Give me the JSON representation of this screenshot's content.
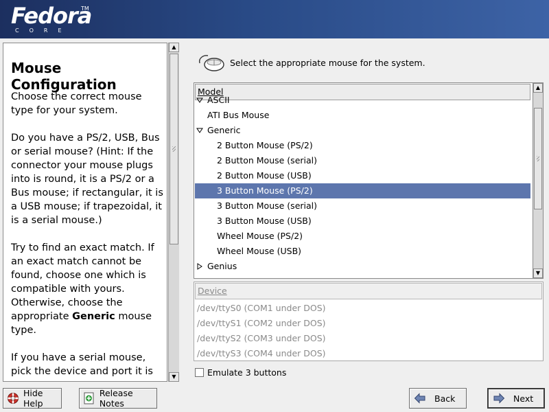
{
  "banner": {
    "logo_text": "Fedora",
    "tm": "TM",
    "core_text": "CORE"
  },
  "help": {
    "title": "Mouse Configuration",
    "paragraph1": "Choose the correct mouse type for your system.",
    "paragraph2": "Do you have a PS/2, USB, Bus or serial mouse? (Hint: If the connector your mouse plugs into is round, it is a PS/2 or a Bus mouse; if rectangular, it is a USB mouse; if trapezoidal, it is a serial mouse.)",
    "paragraph3_pre": "Try to find an exact match. If an exact match cannot be found, choose one which is compatible with yours. Otherwise, choose the appropriate ",
    "paragraph3_bold": "Generic",
    "paragraph3_post": " mouse type.",
    "paragraph4": "If you have a serial mouse, pick the device and port it is"
  },
  "instruction": "Select the appropriate mouse for the system.",
  "model_list": {
    "header": "Model",
    "rows": [
      {
        "label": "ASCII",
        "level": 0,
        "expander": "down",
        "selected": false
      },
      {
        "label": "ATI Bus Mouse",
        "level": 0,
        "expander": "none",
        "selected": false
      },
      {
        "label": "Generic",
        "level": 0,
        "expander": "down",
        "selected": false
      },
      {
        "label": "2 Button Mouse (PS/2)",
        "level": 1,
        "expander": "none",
        "selected": false
      },
      {
        "label": "2 Button Mouse (serial)",
        "level": 1,
        "expander": "none",
        "selected": false
      },
      {
        "label": "2 Button Mouse (USB)",
        "level": 1,
        "expander": "none",
        "selected": false
      },
      {
        "label": "3 Button Mouse (PS/2)",
        "level": 1,
        "expander": "none",
        "selected": true
      },
      {
        "label": "3 Button Mouse (serial)",
        "level": 1,
        "expander": "none",
        "selected": false
      },
      {
        "label": "3 Button Mouse (USB)",
        "level": 1,
        "expander": "none",
        "selected": false
      },
      {
        "label": "Wheel Mouse (PS/2)",
        "level": 1,
        "expander": "none",
        "selected": false
      },
      {
        "label": "Wheel Mouse (USB)",
        "level": 1,
        "expander": "none",
        "selected": false
      },
      {
        "label": "Genius",
        "level": 0,
        "expander": "right",
        "selected": false
      }
    ]
  },
  "device_list": {
    "header": "Device",
    "rows": [
      "/dev/ttyS0 (COM1 under DOS)",
      "/dev/ttyS1 (COM2 under DOS)",
      "/dev/ttyS2 (COM3 under DOS)",
      "/dev/ttyS3 (COM4 under DOS)"
    ],
    "disabled": true
  },
  "emulate": {
    "label": "Emulate 3 buttons",
    "checked": false
  },
  "buttons": {
    "hide_help": "Hide Help",
    "release_notes": "Release Notes",
    "back": "Back",
    "next": "Next"
  },
  "colors": {
    "banner": "#294a86",
    "selection": "#5d76ad",
    "window_bg": "#efefef"
  },
  "icons": {
    "mouse": "mouse-icon",
    "help": "lifebuoy-icon",
    "notes": "document-plus-icon",
    "back": "arrow-left-icon",
    "next": "arrow-right-icon"
  }
}
